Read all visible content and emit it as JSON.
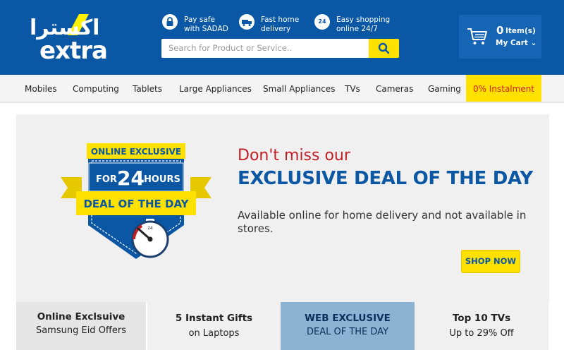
{
  "brand": {
    "logo_arabic": "اكسترا",
    "logo_latin": "extra"
  },
  "features": [
    {
      "icon": "lock-icon",
      "line1": "Pay safe",
      "line2": "with SADAD"
    },
    {
      "icon": "truck-icon",
      "line1": "Fast home",
      "line2": "delivery"
    },
    {
      "icon": "clock-24-icon",
      "icon_text": "24",
      "line1": "Easy shopping",
      "line2": "online 24/7"
    }
  ],
  "search": {
    "placeholder": "Search for Product or Service.."
  },
  "cart": {
    "count": "0",
    "items_label": "Item(s)",
    "my_cart_label": "My Cart ⌄"
  },
  "nav": {
    "items": [
      "Mobiles",
      "Computing",
      "Tablets",
      "Large Appliances",
      "Small Appliances",
      "TVs",
      "Cameras",
      "Gaming"
    ],
    "promo": "0% Instalment"
  },
  "banner": {
    "badge_top": "ONLINE EXCLUSIVE",
    "badge_for": "FOR",
    "badge_num": "24",
    "badge_hours": "HOURS",
    "badge_ribbon": "DEAL OF THE DAY",
    "badge_timer": "24",
    "headline1": "Don't miss our",
    "headline2": "EXCLUSIVE DEAL OF THE DAY",
    "body": "Available online for home delivery and not available in stores.",
    "cta": "SHOP NOW"
  },
  "tabs": [
    {
      "line1": "Online Exclsuive",
      "line2": "Samsung Eid Offers",
      "active": false
    },
    {
      "line1": "5 Instant Gifts",
      "line2": "on Laptops",
      "active": false
    },
    {
      "line1": "WEB EXCLUSIVE",
      "line2": "DEAL OF THE DAY",
      "active": true
    },
    {
      "line1": "Top 10 TVs",
      "line2": "Up to 29% Off",
      "active": false
    }
  ],
  "colors": {
    "header_blue": "#0a57a6",
    "accent_yellow": "#ffe100",
    "headline_red": "#c21f24",
    "active_tab": "#8db3d2"
  }
}
